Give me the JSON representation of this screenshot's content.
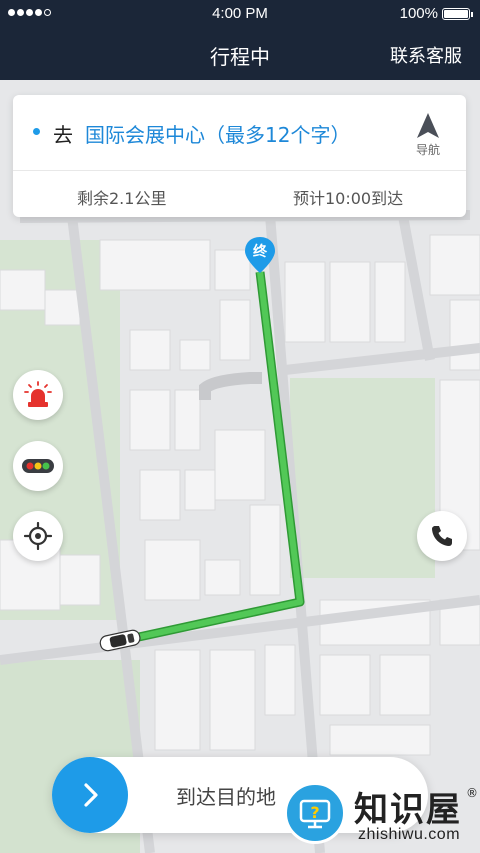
{
  "status_bar": {
    "time": "4:00 PM",
    "battery": "100%"
  },
  "navbar": {
    "title": "行程中",
    "service_label": "联系客服"
  },
  "trip_card": {
    "go_prefix": "去",
    "destination": "国际会展中心（最多12个字）",
    "navigate_label": "导航",
    "remaining": "剩余2.1公里",
    "eta": "预计10:00到达"
  },
  "map": {
    "end_marker_label": "终"
  },
  "bottom_action": {
    "label": "到达目的地"
  },
  "watermark": {
    "brand": "知识屋",
    "reg_mark": "®",
    "url": "zhishiwu.com"
  },
  "colors": {
    "nav_bg": "#1b2638",
    "accent": "#1e9be8",
    "route": "#46c24b",
    "alarm": "#e5322d"
  },
  "icons": [
    "alarm-light-icon",
    "traffic-light-icon",
    "locate-icon",
    "phone-icon",
    "navigate-arrow-icon",
    "chevron-right-icon",
    "car-icon",
    "question-badge-icon"
  ]
}
